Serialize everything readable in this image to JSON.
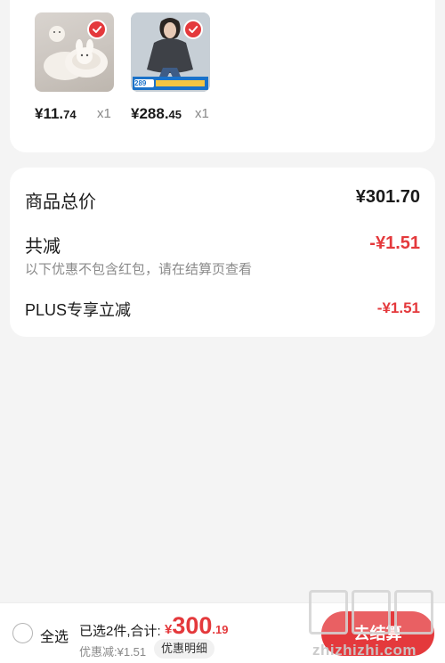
{
  "products": [
    {
      "name": "slipper",
      "price_int": "¥11.",
      "price_dec": "74",
      "qty": "x1"
    },
    {
      "name": "coat",
      "price_int": "¥288.",
      "price_dec": "45",
      "qty": "x1",
      "thumb_tag": "289"
    }
  ],
  "summary": {
    "total_label": "商品总价",
    "total_value": "¥301.70",
    "reduce_label": "共减",
    "reduce_value": "-¥1.51",
    "reduce_note": "以下优惠不包含红包，请在结算页查看",
    "plus_label": "PLUS专享立减",
    "plus_value": "-¥1.51"
  },
  "bottom_bar": {
    "select_all": "全选",
    "selected_text": "已选2件,合计:",
    "total_yen": "¥",
    "total_int": "300",
    "total_dec": ".19",
    "discount_text": "优惠减:¥1.51",
    "detail_button": "优惠明细",
    "checkout_button": "去结算"
  },
  "watermark": {
    "site": "zhizhizhi.com"
  },
  "colors": {
    "accent": "#e4393c",
    "background": "#f4f4f4"
  }
}
